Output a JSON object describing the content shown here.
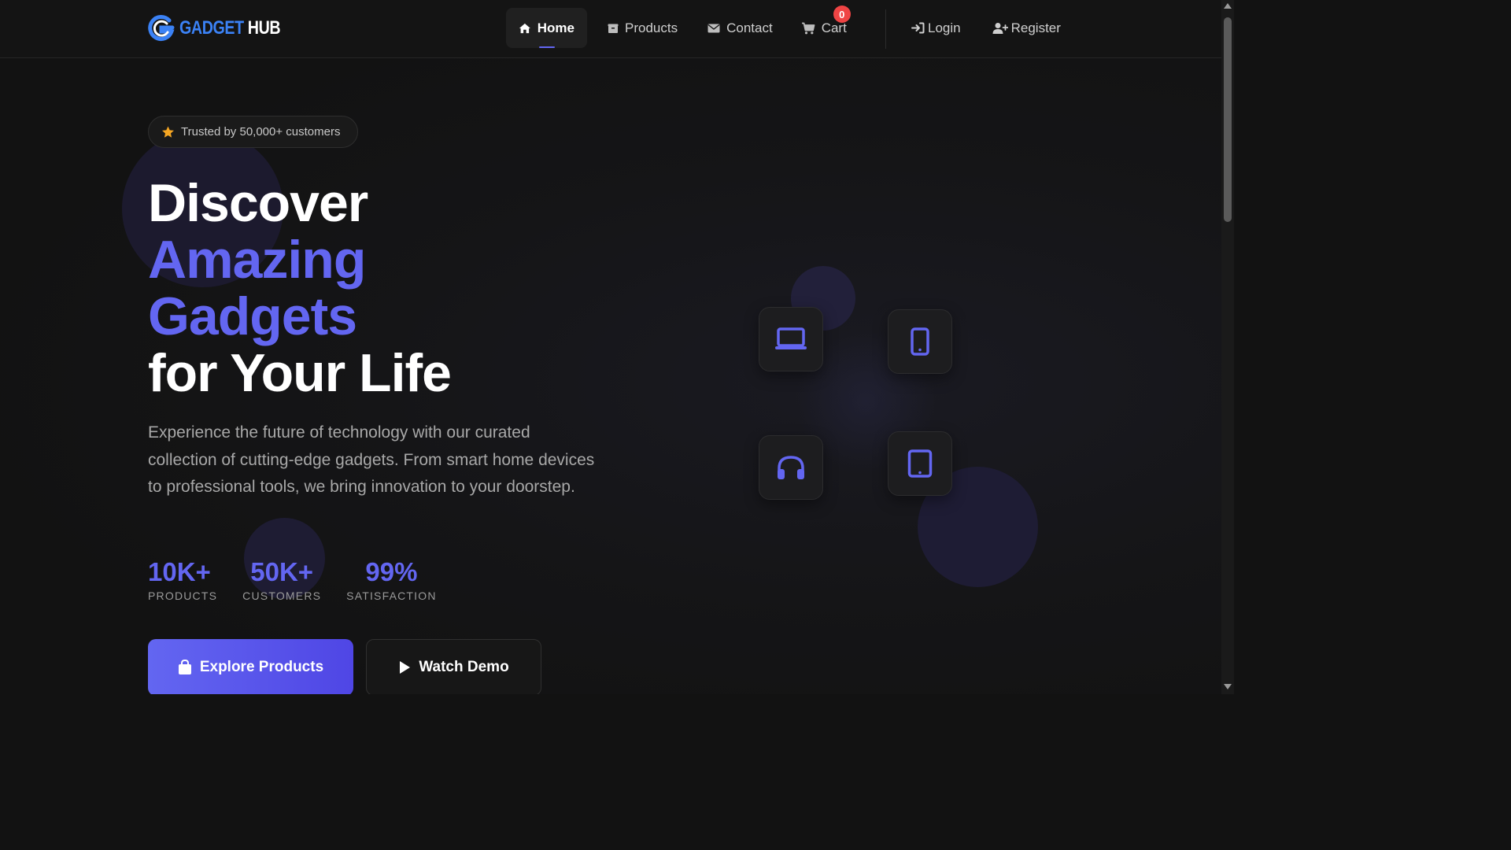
{
  "brand": {
    "name_a": "GADGET",
    "name_b": "HUB",
    "accent": "#3b82f6"
  },
  "nav": {
    "home": "Home",
    "products": "Products",
    "contact": "Contact",
    "cart": "Cart",
    "cart_count": "0",
    "login": "Login",
    "register": "Register"
  },
  "hero": {
    "badge": "Trusted by 50,000+ customers",
    "headline": [
      "Discover",
      "Amazing",
      "Gadgets",
      "for Your Life"
    ],
    "description": "Experience the future of technology with our curated collection of cutting-edge gadgets. From smart home devices to professional tools, we bring innovation to your doorstep.",
    "stats": [
      {
        "value": "10K+",
        "label": "PRODUCTS"
      },
      {
        "value": "50K+",
        "label": "CUSTOMERS"
      },
      {
        "value": "99%",
        "label": "SATISFACTION"
      }
    ],
    "primary_button": "Explore Products",
    "secondary_button": "Watch Demo"
  },
  "device_icons": [
    "laptop-icon",
    "mobile-phone-icon",
    "headphones-icon",
    "tablet-icon"
  ],
  "colors": {
    "accent": "#6366f1",
    "background": "#121212",
    "badge_red": "#ef4444",
    "star": "#f5a623"
  }
}
